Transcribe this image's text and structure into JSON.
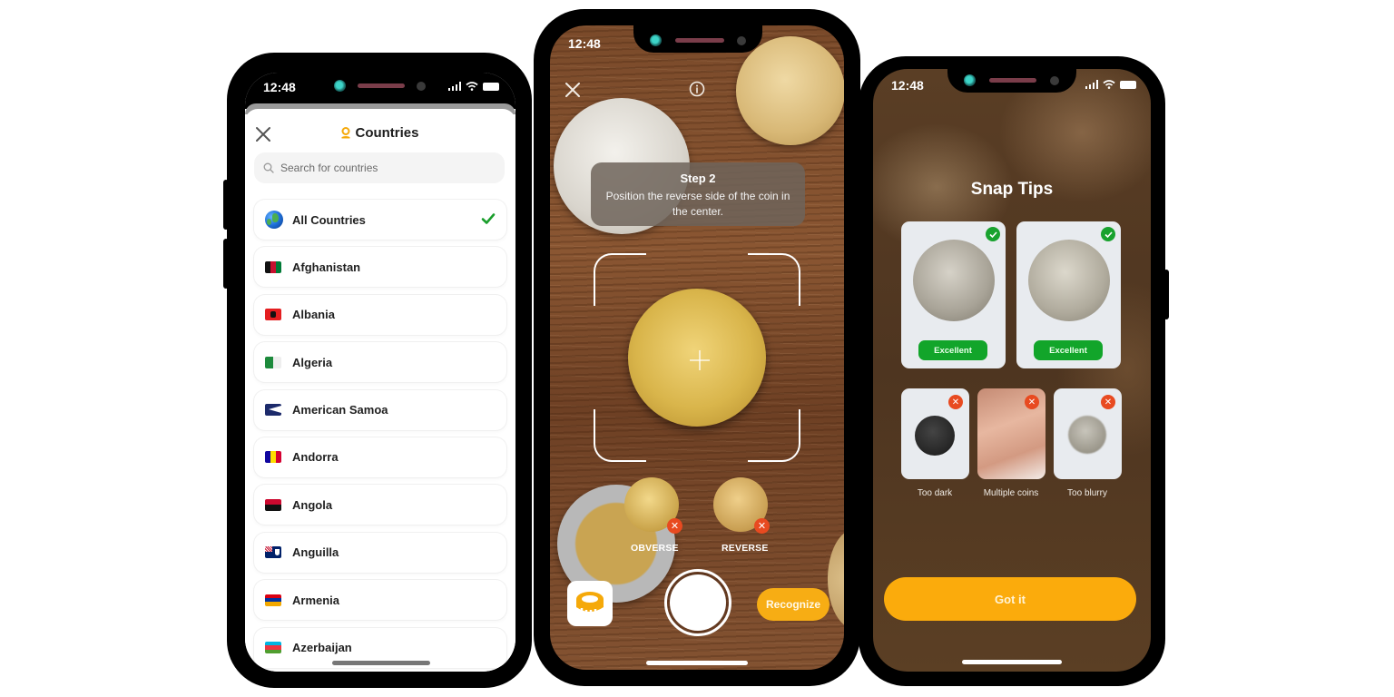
{
  "status_bar": {
    "time": "12:48"
  },
  "countries_screen": {
    "title": "Countries",
    "close_icon": "close-icon",
    "title_icon": "location-pin-icon",
    "search": {
      "placeholder": "Search for countries",
      "value": ""
    },
    "items": [
      {
        "label": "All Countries",
        "icon": "globe-icon",
        "selected": true
      },
      {
        "label": "Afghanistan",
        "icon": "flag-af"
      },
      {
        "label": "Albania",
        "icon": "flag-al"
      },
      {
        "label": "Algeria",
        "icon": "flag-dz"
      },
      {
        "label": "American Samoa",
        "icon": "flag-as"
      },
      {
        "label": "Andorra",
        "icon": "flag-ad"
      },
      {
        "label": "Angola",
        "icon": "flag-ao"
      },
      {
        "label": "Anguilla",
        "icon": "flag-ai"
      },
      {
        "label": "Armenia",
        "icon": "flag-am"
      },
      {
        "label": "Azerbaijan",
        "icon": "flag-az"
      }
    ],
    "check_color": "#1a9e2c"
  },
  "camera_screen": {
    "step_title": "Step 2",
    "step_description": "Position the reverse side of the coin in the center.",
    "obverse_label": "OBVERSE",
    "reverse_label": "REVERSE",
    "recognize_label": "Recognize",
    "accent_color": "#f7ad14"
  },
  "snap_tips_screen": {
    "title": "Snap Tips",
    "good_examples": [
      {
        "label": "Excellent",
        "side": "obverse"
      },
      {
        "label": "Excellent",
        "side": "reverse"
      }
    ],
    "bad_examples": [
      {
        "caption": "Too dark"
      },
      {
        "caption": "Multiple coins"
      },
      {
        "caption": "Too blurry"
      }
    ],
    "got_it_label": "Got it",
    "good_color": "#12a52a",
    "bad_color": "#e84a20",
    "accent_color": "#fbab0c"
  }
}
